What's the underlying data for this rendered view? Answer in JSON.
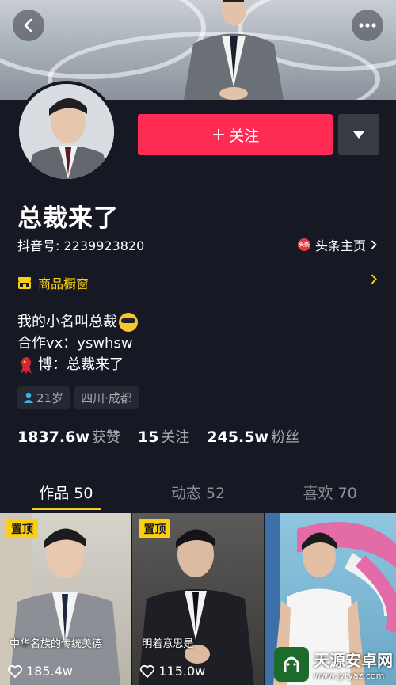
{
  "header": {
    "back_icon": "chevron-left-icon",
    "more_icon": "more-dots-icon"
  },
  "profile": {
    "follow_label": "关注",
    "follow_plus": "+",
    "name": "总裁来了",
    "douyin_id": "抖音号: 2239923820",
    "toutiao_label": "头条主页",
    "toutiao_icon_text": "头条",
    "shop_label": "商品橱窗",
    "bio": {
      "line1": "我的小名叫总裁",
      "line2": "合作vx：yswhsw",
      "line3": "博：总裁来了"
    },
    "tags": {
      "age": "21岁",
      "location": "四川·成都"
    }
  },
  "stats": {
    "likes_value": "1837.6w",
    "likes_label": "获赞",
    "following_value": "15",
    "following_label": "关注",
    "followers_value": "245.5w",
    "followers_label": "粉丝"
  },
  "tabs": [
    {
      "label": "作品 50"
    },
    {
      "label": "动态 52"
    },
    {
      "label": "喜欢 70"
    }
  ],
  "videos": [
    {
      "pinned": "置顶",
      "likes": "185.4w",
      "caption": "中华名族的传统美德"
    },
    {
      "pinned": "置顶",
      "likes": "115.0w",
      "caption": "明着意思是"
    },
    {
      "pinned": "",
      "likes": "",
      "caption": ""
    }
  ],
  "watermark": {
    "name": "天源安卓网",
    "url": "www.jytyaz.com"
  },
  "colors": {
    "background": "#161823",
    "follow_button": "#fe2c55",
    "accent_yellow": "#face15"
  }
}
